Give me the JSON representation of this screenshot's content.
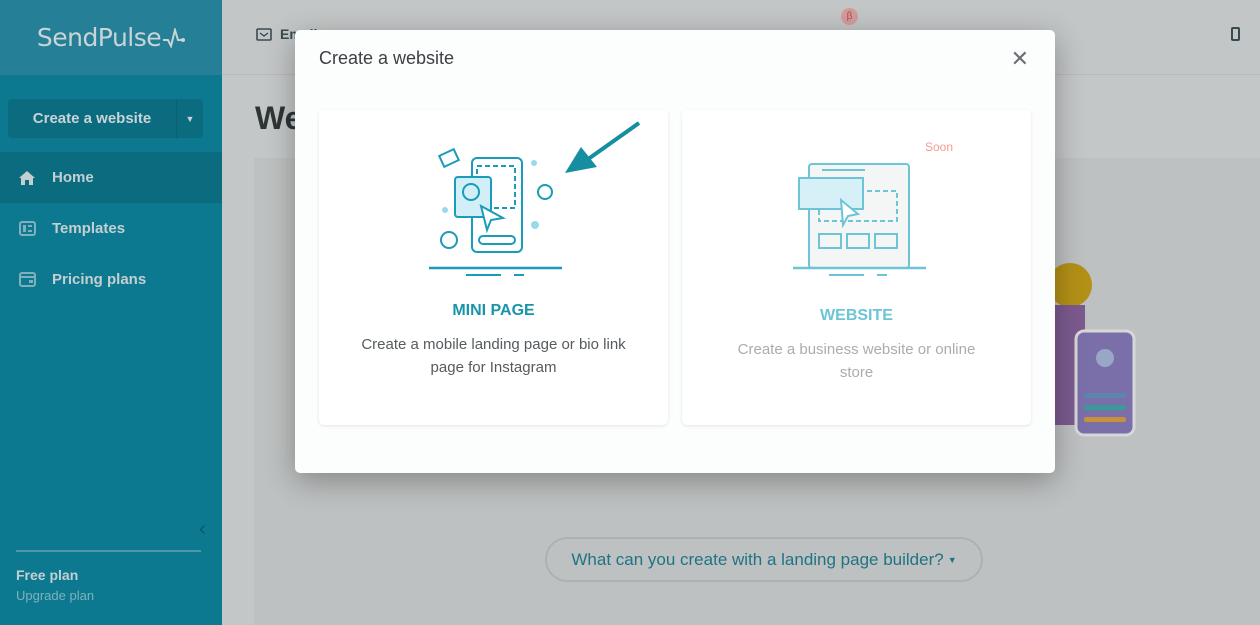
{
  "brand": {
    "name": "SendPulse"
  },
  "sidebar": {
    "create_button": "Create a website",
    "items": [
      {
        "label": "Home",
        "icon": "home-icon",
        "active": true
      },
      {
        "label": "Templates",
        "icon": "templates-icon"
      },
      {
        "label": "Pricing plans",
        "icon": "wallet-icon"
      }
    ],
    "plan": "Free plan",
    "upgrade": "Upgrade plan"
  },
  "topnav": {
    "items": [
      {
        "label": "Email",
        "icon": "mail-icon"
      }
    ],
    "beta_badge": "β"
  },
  "page": {
    "title": "Websites",
    "help_button": "What can you create with a landing page builder?"
  },
  "modal": {
    "title": "Create a website",
    "cards": [
      {
        "title": "MINI PAGE",
        "description": "Create a mobile landing page or bio link page for Instagram"
      },
      {
        "title": "WEBSITE",
        "description": "Create a business website or online store",
        "badge": "Soon"
      }
    ]
  },
  "colors": {
    "accent": "#1a94ab",
    "sidebar": "#0c7990",
    "soon": "#f39a8f"
  }
}
